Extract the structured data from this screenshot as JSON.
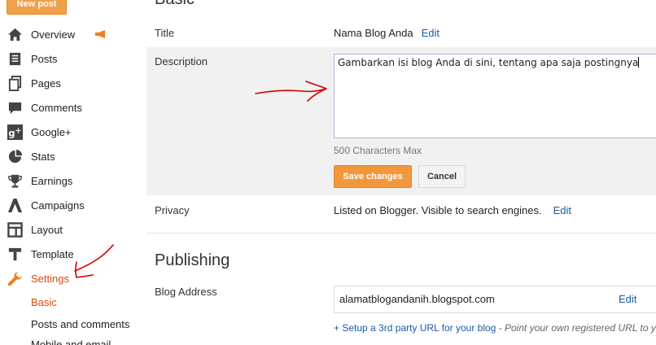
{
  "sidebar": {
    "new_post_label": "New post",
    "items": [
      {
        "label": "Overview",
        "icon": "home-icon"
      },
      {
        "label": "Posts",
        "icon": "posts-icon"
      },
      {
        "label": "Pages",
        "icon": "pages-icon"
      },
      {
        "label": "Comments",
        "icon": "comment-icon"
      },
      {
        "label": "Google+",
        "icon": "googleplus-icon"
      },
      {
        "label": "Stats",
        "icon": "pie-chart-icon"
      },
      {
        "label": "Earnings",
        "icon": "trophy-icon"
      },
      {
        "label": "Campaigns",
        "icon": "campaigns-icon"
      },
      {
        "label": "Layout",
        "icon": "layout-icon"
      },
      {
        "label": "Template",
        "icon": "template-icon"
      },
      {
        "label": "Settings",
        "icon": "wrench-icon",
        "active": true
      }
    ],
    "sub_items": [
      {
        "label": "Basic",
        "active": true
      },
      {
        "label": "Posts and comments"
      },
      {
        "label": "Mobile and email"
      }
    ]
  },
  "main": {
    "basic_title": "Basic",
    "title_row": {
      "label": "Title",
      "value": "Nama Blog Anda",
      "edit": "Edit"
    },
    "description_row": {
      "label": "Description",
      "value": "Gambarkan isi blog Anda di sini, tentang apa saja postingnya",
      "char_limit": "500 Characters Max",
      "save_label": "Save changes",
      "cancel_label": "Cancel"
    },
    "privacy_row": {
      "label": "Privacy",
      "value": "Listed on Blogger. Visible to search engines.",
      "edit": "Edit"
    },
    "publishing_title": "Publishing",
    "blog_address_row": {
      "label": "Blog Address",
      "value": "alamatblogandanih.blogspot.com",
      "edit": "Edit",
      "setup_link": "+ Setup a 3rd party URL for your blog",
      "setup_hint": " - Point your own registered URL to y"
    }
  },
  "colors": {
    "accent_orange": "#f3973d",
    "active_nav": "#dd4b07",
    "link_blue": "#1a5aa6",
    "annotation_red": "#d40000"
  }
}
